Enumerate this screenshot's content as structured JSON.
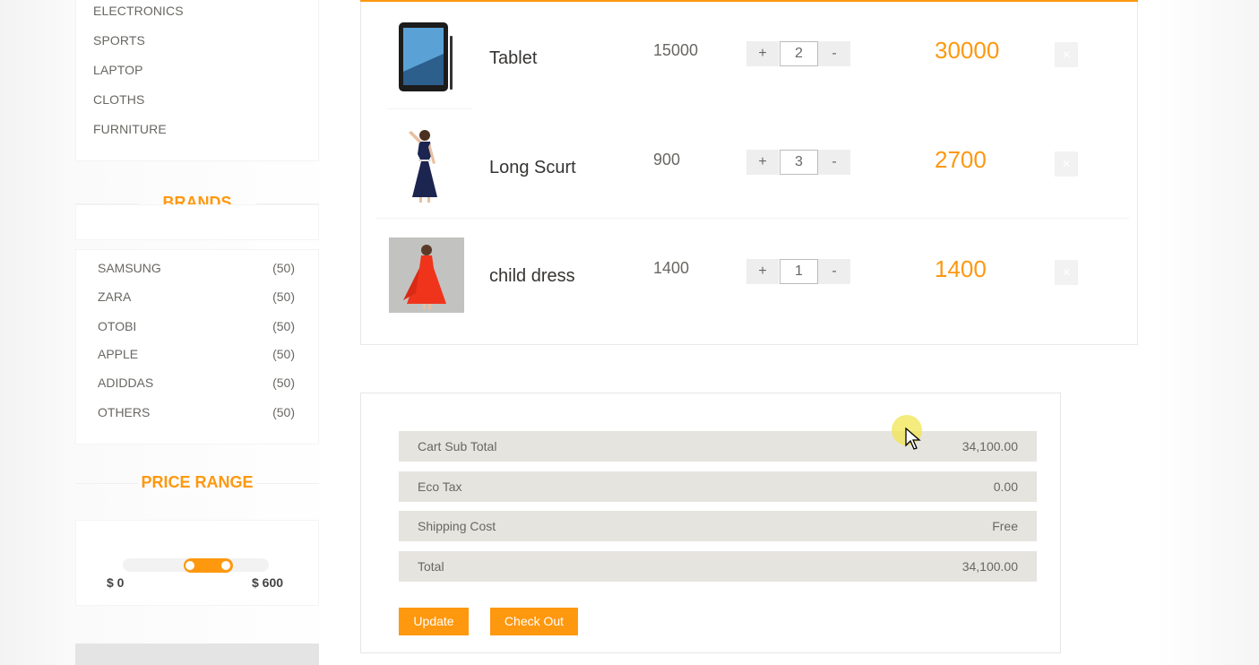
{
  "sidebar": {
    "categories": [
      "ELECTRONICS",
      "SPORTS",
      "LAPTOP",
      "CLOTHS",
      "FURNITURE"
    ],
    "brands_title": "BRANDS",
    "brands": [
      {
        "name": "SAMSUNG",
        "count": "(50)"
      },
      {
        "name": "ZARA",
        "count": "(50)"
      },
      {
        "name": "OTOBI",
        "count": "(50)"
      },
      {
        "name": "APPLE",
        "count": "(50)"
      },
      {
        "name": "ADIDDAS",
        "count": "(50)"
      },
      {
        "name": "OTHERS",
        "count": "(50)"
      }
    ],
    "price_range": {
      "title": "PRICE RANGE",
      "min_label": "$ 0",
      "max_label": "$ 600"
    }
  },
  "cart": {
    "items": [
      {
        "name": "Tablet",
        "price": "15000",
        "qty": "2",
        "total": "30000",
        "plus": "+",
        "minus": "-"
      },
      {
        "name": "Long Scurt",
        "price": "900",
        "qty": "3",
        "total": "2700",
        "plus": "+",
        "minus": "-"
      },
      {
        "name": "child dress",
        "price": "1400",
        "qty": "1",
        "total": "1400",
        "plus": "+",
        "minus": "-"
      }
    ]
  },
  "totals": {
    "rows": [
      {
        "label": "Cart Sub Total",
        "value": "34,100.00"
      },
      {
        "label": "Eco Tax",
        "value": "0.00"
      },
      {
        "label": "Shipping Cost",
        "value": "Free"
      },
      {
        "label": "Total",
        "value": "34,100.00"
      }
    ],
    "update_label": "Update",
    "checkout_label": "Check Out"
  },
  "colors": {
    "accent": "#FE980F",
    "text": "#696763",
    "row_bg": "#E6E4DF"
  }
}
